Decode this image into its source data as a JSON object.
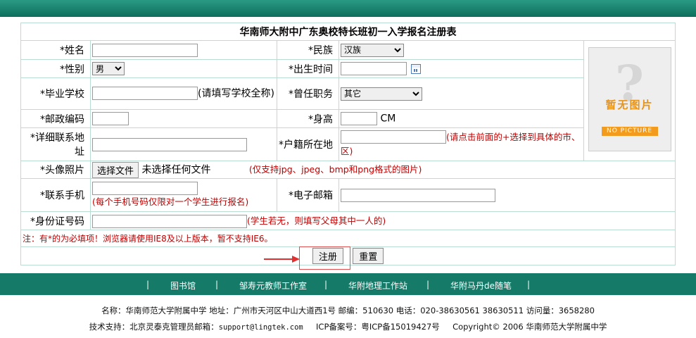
{
  "form": {
    "title": "华南师大附中广东奥校特长班初一入学报名注册表",
    "name_label": "*姓名",
    "ethnicity_label": "*民族",
    "ethnicity_value": "汉族",
    "gender_label": "*性别",
    "gender_value": "男",
    "birth_label": "*出生时间",
    "school_label": "*毕业学校",
    "school_hint": "(请填写学校全称)",
    "position_label": "*曾任职务",
    "position_value": "其它",
    "postcode_label": "*邮政编码",
    "height_label": "*身高",
    "height_unit": "CM",
    "address_label": "*详细联系地址",
    "hukou_label": "*户籍所在地",
    "hukou_hint": "(请点击前面的+选择到具体的市、区)",
    "photo_label": "*头像照片",
    "file_button": "选择文件",
    "file_status": "未选择任何文件",
    "photo_hint": "(仅支持jpg、jpeg、bmp和png格式的图片)",
    "mobile_label": "*联系手机",
    "mobile_hint": "(每个手机号码仅限对一个学生进行报名)",
    "email_label": "*电子邮箱",
    "id_label": "*身份证号码",
    "id_hint": "(学生若无，则填写父母其中一人的)",
    "note": "注：有*的为必填项！浏览器请使用IE8及以上版本，暂不支持IE6。",
    "submit_label": "注册",
    "reset_label": "重置",
    "photo_placeholder_cn": "暂无图片",
    "photo_placeholder_en": "NO PICTURE"
  },
  "nav": {
    "items": [
      "图书馆",
      "邹寿元教师工作室",
      "华附地理工作站",
      "华附马丹de随笔"
    ],
    "separator": "|"
  },
  "footer": {
    "line1": "名称：华南师范大学附属中学  地址：广州市天河区中山大道西1号  邮编：510630 电话：020-38630561 38630511    访问量：3658280",
    "line2_prefix": "技术支持：北京灵泰克管理员邮箱：",
    "line2_email": "support@lingtek.com",
    "line2_icp": "ICP备案号：粤ICP备15019427号",
    "line2_copyright": "Copyright© 2006 华南师范大学附属中学"
  },
  "colors": {
    "header_green": "#157a68",
    "required_red": "#c00000"
  }
}
